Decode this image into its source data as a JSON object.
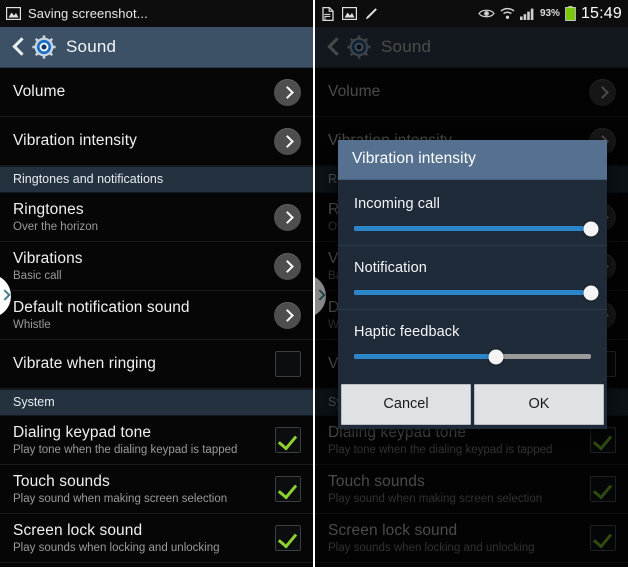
{
  "left_panel": {
    "status_bar": {
      "icons": [
        "image-icon"
      ],
      "text": "Saving screenshot..."
    },
    "action_bar": {
      "back_icon": "back-chevron-icon",
      "app_icon": "settings-gear-icon",
      "title": "Sound"
    },
    "rows": [
      {
        "type": "item",
        "title": "Volume",
        "subtitle": "",
        "accessory": "chevron"
      },
      {
        "type": "item",
        "title": "Vibration intensity",
        "subtitle": "",
        "accessory": "chevron"
      },
      {
        "type": "header",
        "title": "Ringtones and notifications"
      },
      {
        "type": "item",
        "title": "Ringtones",
        "subtitle": "Over the horizon",
        "accessory": "chevron"
      },
      {
        "type": "item",
        "title": "Vibrations",
        "subtitle": "Basic call",
        "accessory": "chevron"
      },
      {
        "type": "item",
        "title": "Default notification sound",
        "subtitle": "Whistle",
        "accessory": "chevron"
      },
      {
        "type": "item",
        "title": "Vibrate when ringing",
        "subtitle": "",
        "accessory": "checkbox",
        "checked": false
      },
      {
        "type": "header",
        "title": "System"
      },
      {
        "type": "item",
        "title": "Dialing keypad tone",
        "subtitle": "Play tone when the dialing keypad is tapped",
        "accessory": "checkbox",
        "checked": true
      },
      {
        "type": "item",
        "title": "Touch sounds",
        "subtitle": "Play sound when making screen selection",
        "accessory": "checkbox",
        "checked": true
      },
      {
        "type": "item",
        "title": "Screen lock sound",
        "subtitle": "Play sounds when locking and unlocking",
        "accessory": "checkbox",
        "checked": true
      }
    ],
    "edge_tab": {
      "icon": "chevron-right-icon"
    }
  },
  "right_panel": {
    "status_bar": {
      "icons": [
        "document-error-icon",
        "image-icon",
        "pencil-icon",
        "eye-icon",
        "wifi-icon",
        "signal-icon"
      ],
      "battery_percent": "93%",
      "clock": "15:49"
    },
    "action_bar": {
      "back_icon": "back-chevron-icon",
      "app_icon": "settings-gear-icon",
      "title": "Sound"
    },
    "edge_tab": {
      "icon": "chevron-right-icon"
    },
    "dialog": {
      "title": "Vibration intensity",
      "sliders": [
        {
          "label": "Incoming call",
          "value": 100
        },
        {
          "label": "Notification",
          "value": 100
        },
        {
          "label": "Haptic feedback",
          "value": 60
        }
      ],
      "cancel_label": "Cancel",
      "ok_label": "OK"
    }
  },
  "colors": {
    "action_bar": "#3d5166",
    "section_header": "#24313f",
    "dialog_title": "#55718f",
    "dialog_body": "#1f2b38",
    "slider_fill": "#2a86c8",
    "checkmark": "#8fd130",
    "battery": "#7ac70c"
  }
}
